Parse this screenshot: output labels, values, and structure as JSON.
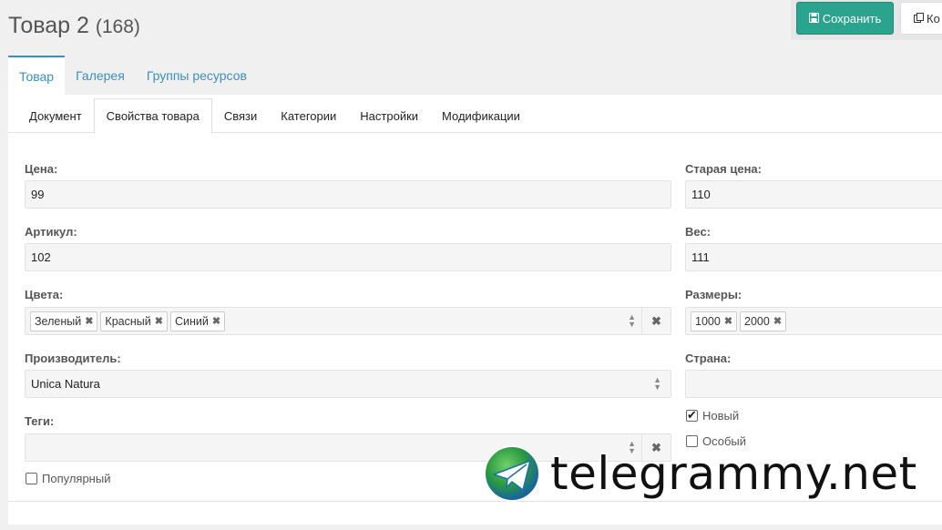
{
  "header": {
    "title": "Товар 2",
    "resource_id": "(168)"
  },
  "actions": {
    "save_label": "Сохранить",
    "copy_label": "Ко"
  },
  "main_tabs": [
    {
      "label": "Товар",
      "active": true
    },
    {
      "label": "Галерея",
      "active": false
    },
    {
      "label": "Группы ресурсов",
      "active": false
    }
  ],
  "sub_tabs": [
    {
      "label": "Документ",
      "active": false
    },
    {
      "label": "Свойства товара",
      "active": true
    },
    {
      "label": "Связи",
      "active": false
    },
    {
      "label": "Категории",
      "active": false
    },
    {
      "label": "Настройки",
      "active": false
    },
    {
      "label": "Модификации",
      "active": false
    }
  ],
  "form": {
    "price": {
      "label": "Цена:",
      "value": "99"
    },
    "old_price": {
      "label": "Старая цена:",
      "value": "110"
    },
    "article": {
      "label": "Артикул:",
      "value": "102"
    },
    "weight": {
      "label": "Вес:",
      "value": "111"
    },
    "colors": {
      "label": "Цвета:",
      "tags": [
        "Зеленый",
        "Красный",
        "Синий"
      ]
    },
    "sizes": {
      "label": "Размеры:",
      "tags": [
        "1000",
        "2000"
      ]
    },
    "vendor": {
      "label": "Производитель:",
      "value": "Unica Natura"
    },
    "country": {
      "label": "Страна:",
      "value": ""
    },
    "tags": {
      "label": "Теги:",
      "value": ""
    },
    "new": {
      "label": "Новый",
      "checked": true
    },
    "special": {
      "label": "Особый",
      "checked": false
    },
    "popular": {
      "label": "Популярный",
      "checked": false
    }
  },
  "icons": {
    "save": "floppy-icon",
    "copy": "copy-icon",
    "remove": "times-icon",
    "select": "sort-icon"
  },
  "colors": {
    "accent": "#2aa38f",
    "link": "#3a8fbd"
  },
  "watermark": {
    "text": "telegrammy.net"
  }
}
